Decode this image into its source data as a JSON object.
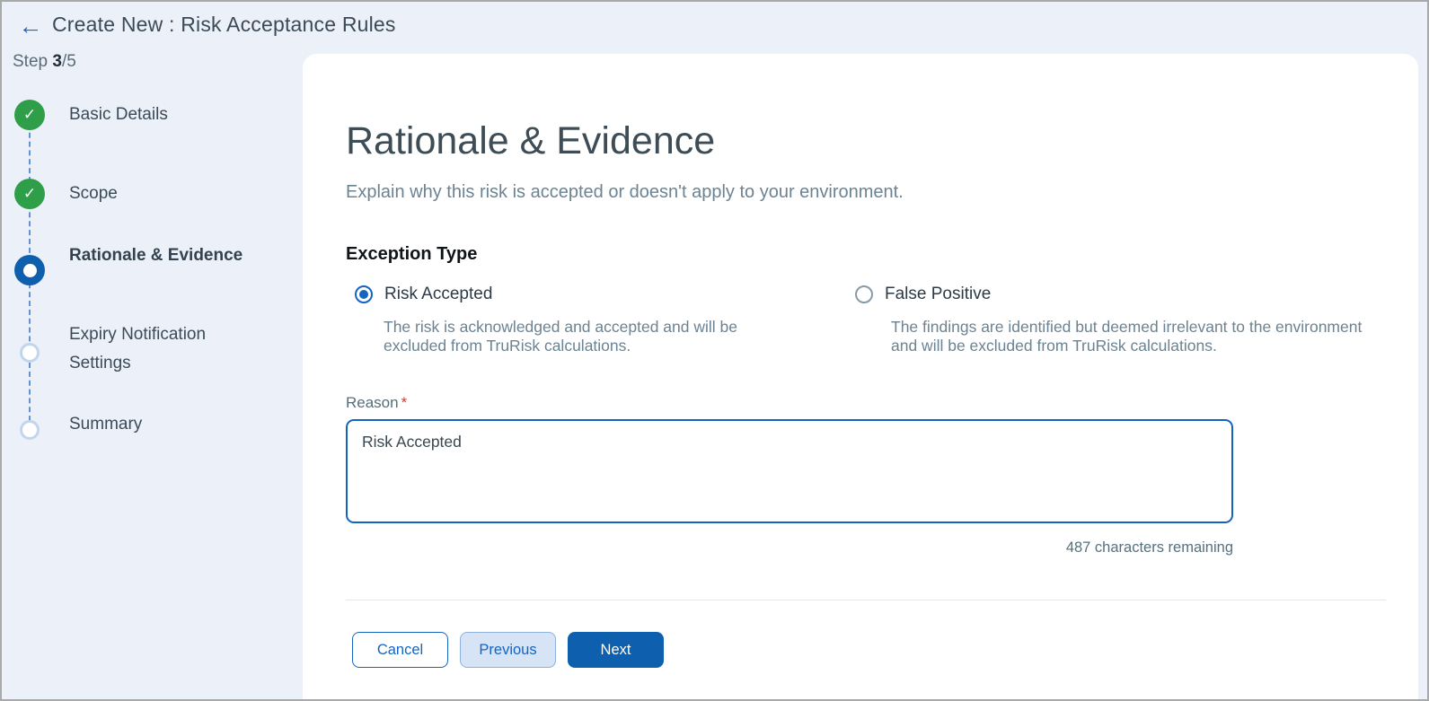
{
  "header": {
    "back_icon": "←",
    "title": "Create New : Risk Acceptance Rules"
  },
  "stepper": {
    "step_word": "Step",
    "current_step": "3",
    "total_suffix": "/5",
    "steps": [
      {
        "label": "Basic Details",
        "state": "completed",
        "icon": "check"
      },
      {
        "label": "Scope",
        "state": "completed",
        "icon": "check"
      },
      {
        "label": "Rationale & Evidence",
        "state": "active",
        "icon": "dot"
      },
      {
        "label": "Expiry Notification Settings",
        "state": "upcoming",
        "icon": "circle"
      },
      {
        "label": "Summary",
        "state": "upcoming",
        "icon": "circle"
      }
    ],
    "check_glyph": "✓"
  },
  "main": {
    "title": "Rationale & Evidence",
    "subtitle": "Explain why this risk is accepted or doesn't apply to your environment.",
    "exception_type": {
      "label": "Exception Type",
      "options": [
        {
          "label": "Risk Accepted",
          "selected": true,
          "description": "The risk is acknowledged and accepted and will be excluded from TruRisk calculations."
        },
        {
          "label": "False Positive",
          "selected": false,
          "description": "The findings are identified but deemed irrelevant to the environment and will be excluded from TruRisk calculations."
        }
      ]
    },
    "reason": {
      "label": "Reason",
      "required_marker": "*",
      "value": "Risk Accepted",
      "remaining_text": "487 characters remaining"
    },
    "buttons": {
      "cancel": "Cancel",
      "previous": "Previous",
      "next": "Next"
    }
  },
  "colors": {
    "page_background": "#ECF1F9",
    "card_background": "#FFFFFF",
    "accent_blue": "#1565C0",
    "active_step_blue": "#0E5FAE",
    "success_green": "#2E9E48",
    "required_red": "#E0342C",
    "muted_text": "#6B8392",
    "dark_text": "#3A4A57"
  }
}
